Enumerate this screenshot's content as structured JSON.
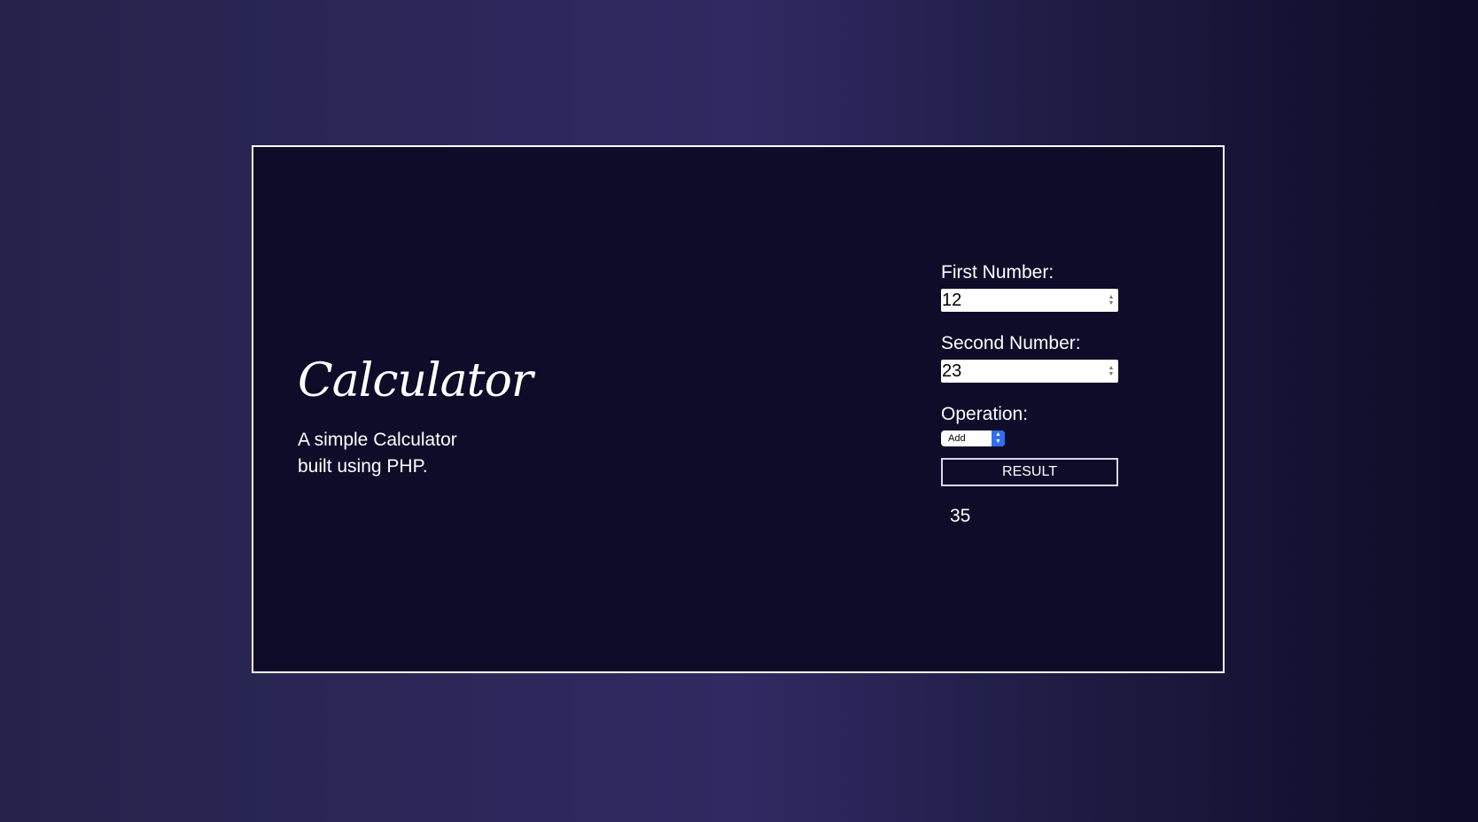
{
  "app": {
    "title": "Calculator",
    "subtitle": "A simple Calculator built using PHP."
  },
  "form": {
    "first_label": "First Number:",
    "first_value": "12",
    "second_label": "Second Number:",
    "second_value": "23",
    "operation_label": "Operation:",
    "operation_selected": "Add",
    "button_label": "RESULT",
    "result": "35"
  },
  "icons": {
    "spinner": "up-down-spinner-icon",
    "select_arrows": "chevron-up-down-icon"
  },
  "colors": {
    "card_background": "#0e0c29",
    "card_border": "#ffffff",
    "select_accent": "#2f6ff0"
  }
}
